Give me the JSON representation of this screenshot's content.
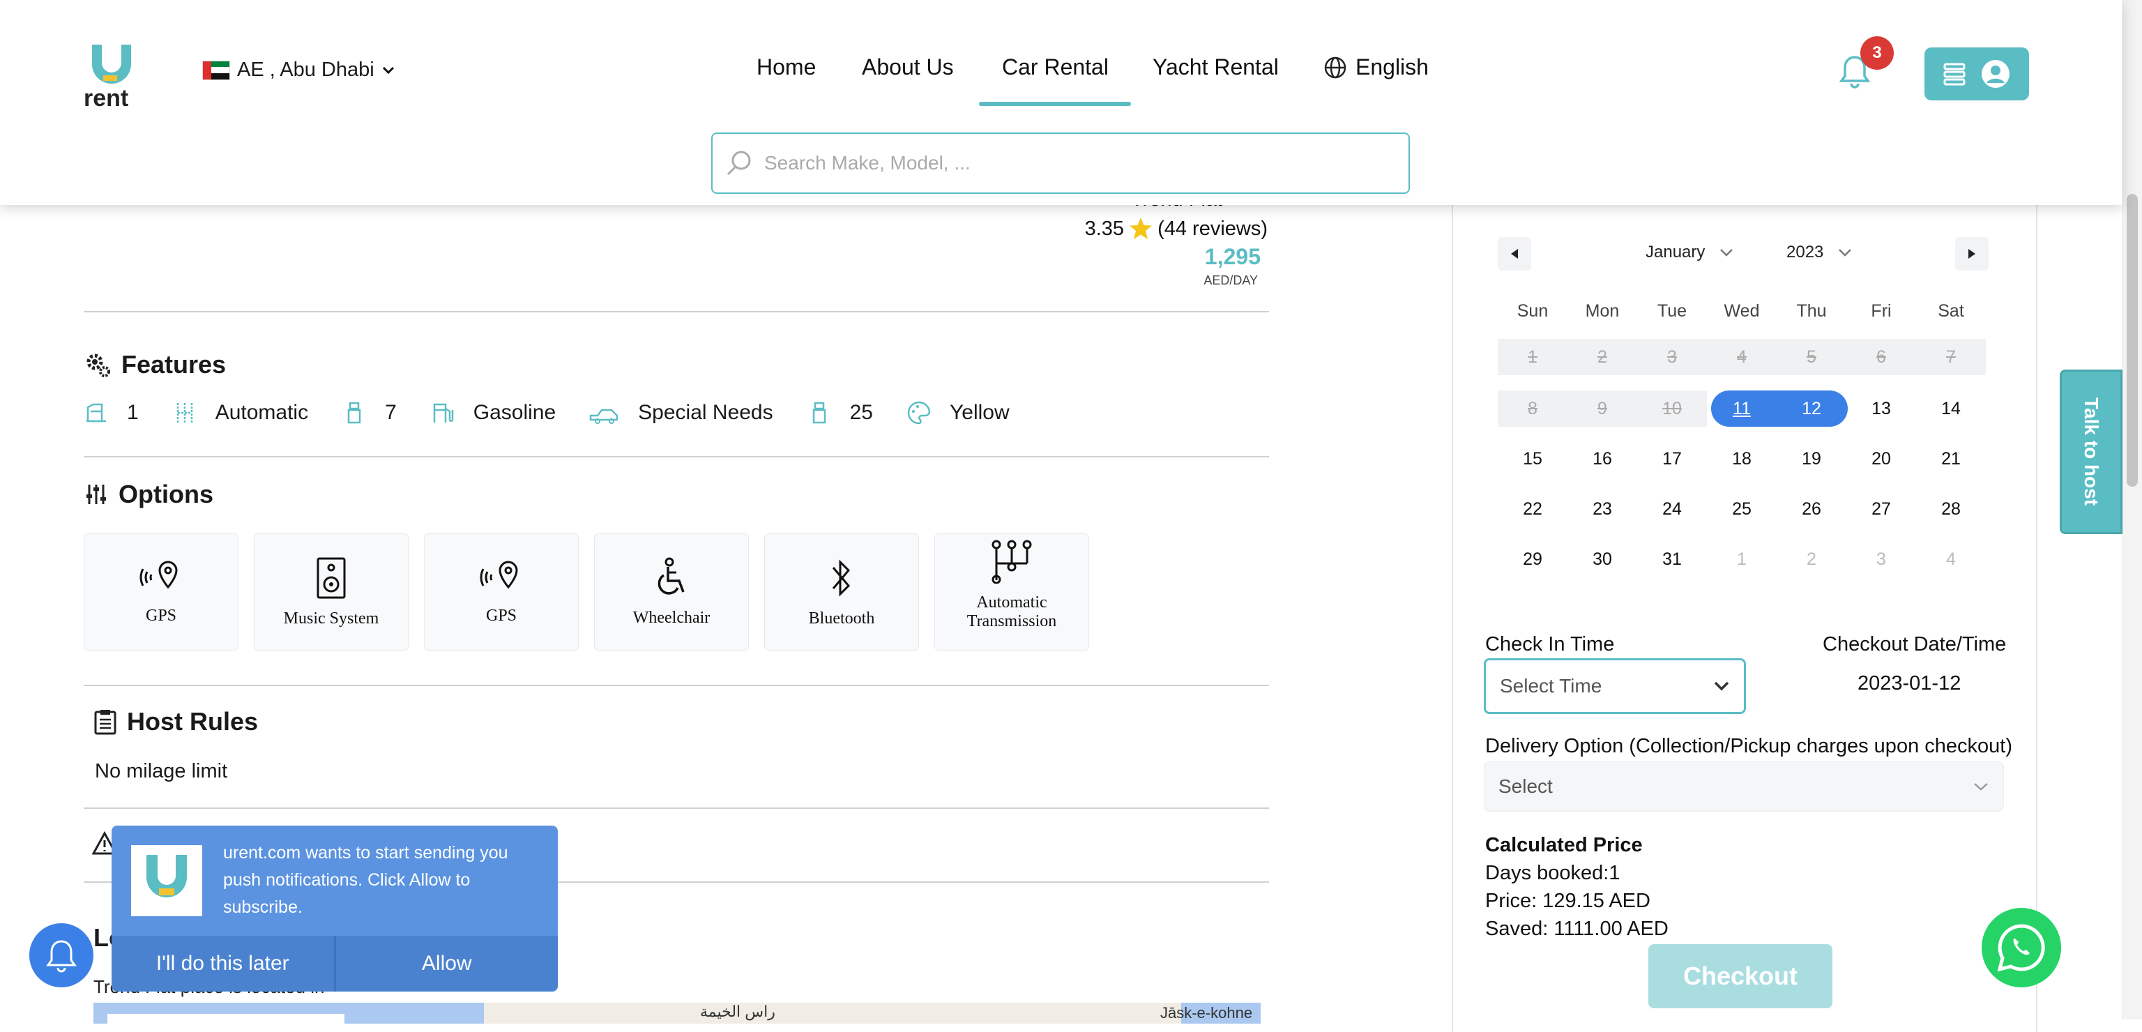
{
  "header": {
    "location": "AE , Abu Dhabi",
    "nav": [
      "Home",
      "About Us",
      "Car Rental",
      "Yacht Rental"
    ],
    "language": "English",
    "notification_count": "3",
    "search_placeholder": "Search Make, Model, ..."
  },
  "car": {
    "name_partial": "Trend Fiat",
    "rating": "3.35",
    "reviews": "(44 reviews)",
    "price": "1,295",
    "price_unit": "AED/DAY"
  },
  "features": {
    "title": "Features",
    "items": [
      {
        "icon": "seat-icon",
        "value": "1"
      },
      {
        "icon": "gear-shift-icon",
        "value": "Automatic"
      },
      {
        "icon": "seat-count-icon",
        "value": "7"
      },
      {
        "icon": "fuel-icon",
        "value": "Gasoline"
      },
      {
        "icon": "special-needs-icon",
        "value": "Special Needs"
      },
      {
        "icon": "age-icon",
        "value": "25"
      },
      {
        "icon": "paint-icon",
        "value": "Yellow"
      }
    ]
  },
  "options": {
    "title": "Options",
    "items": [
      {
        "icon": "gps-icon",
        "label": "GPS"
      },
      {
        "icon": "speaker-icon",
        "label": "Music System"
      },
      {
        "icon": "gps-icon",
        "label": "GPS"
      },
      {
        "icon": "wheelchair-icon",
        "label": "Wheelchair"
      },
      {
        "icon": "bluetooth-icon",
        "label": "Bluetooth"
      },
      {
        "icon": "transmission-icon",
        "label": "Automatic Transmission"
      }
    ]
  },
  "host_rules": {
    "title": "Host Rules",
    "text": "No milage limit"
  },
  "location": {
    "title_partial": "Lo",
    "text_partial": "Trend Fiat place is located in",
    "map_labels": [
      "راس الخيمة",
      "Jāsk-e-kohne"
    ]
  },
  "calendar": {
    "month": "January",
    "year": "2023",
    "weekdays": [
      "Sun",
      "Mon",
      "Tue",
      "Wed",
      "Thu",
      "Fri",
      "Sat"
    ],
    "weeks": [
      [
        "1",
        "2",
        "3",
        "4",
        "5",
        "6",
        "7"
      ],
      [
        "8",
        "9",
        "10",
        "11",
        "12",
        "13",
        "14"
      ],
      [
        "15",
        "16",
        "17",
        "18",
        "19",
        "20",
        "21"
      ],
      [
        "22",
        "23",
        "24",
        "25",
        "26",
        "27",
        "28"
      ],
      [
        "29",
        "30",
        "31",
        "1",
        "2",
        "3",
        "4"
      ]
    ],
    "selected_start": "11",
    "selected_end": "12"
  },
  "booking": {
    "check_in_label": "Check In Time",
    "check_in_placeholder": "Select Time",
    "checkout_label": "Checkout Date/Time",
    "checkout_value": "2023-01-12",
    "delivery_label": "Delivery Option (Collection/Pickup charges upon checkout)",
    "delivery_placeholder": "Select",
    "calc_title": "Calculated Price",
    "days_booked": "Days booked:1",
    "price": "Price: 129.15 AED",
    "saved": "Saved: 1111.00 AED",
    "checkout_button": "Checkout"
  },
  "talk_to_host": "Talk to host",
  "push": {
    "message": "urent.com wants to start sending you push notifications. Click Allow to subscribe.",
    "later": "I'll do this later",
    "allow": "Allow"
  },
  "colors": {
    "accent": "#5bbdc4",
    "selected_day": "#3b80e6",
    "push_bg": "#5b93e0",
    "badge": "#d93a35",
    "whatsapp": "#25d366"
  }
}
